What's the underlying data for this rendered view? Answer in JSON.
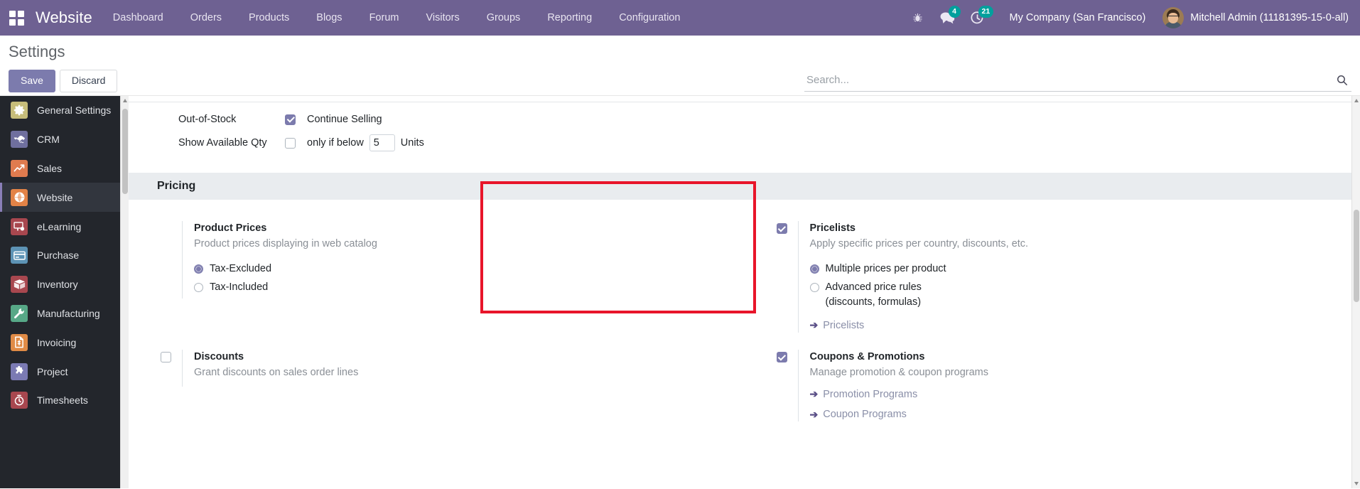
{
  "navbar": {
    "apps_icon": "apps-grid-icon",
    "brand": "Website",
    "menu": [
      {
        "label": "Dashboard"
      },
      {
        "label": "Orders"
      },
      {
        "label": "Products"
      },
      {
        "label": "Blogs"
      },
      {
        "label": "Forum"
      },
      {
        "label": "Visitors"
      },
      {
        "label": "Groups"
      },
      {
        "label": "Reporting"
      },
      {
        "label": "Configuration"
      }
    ],
    "debug_icon": "bug-icon",
    "messages_icon": "chat-bubble-icon",
    "messages_count": "4",
    "activities_icon": "clock-icon",
    "activities_count": "21",
    "company": "My Company (San Francisco)",
    "avatar_icon": "user-avatar",
    "user": "Mitchell Admin (11181395-15-0-all)"
  },
  "control_panel": {
    "title": "Settings",
    "save_label": "Save",
    "discard_label": "Discard",
    "search_placeholder": "Search...",
    "search_value": "",
    "search_icon": "magnifier-icon"
  },
  "sidebar": {
    "items": [
      {
        "label": "General Settings",
        "icon": "gear-icon",
        "active": false
      },
      {
        "label": "CRM",
        "icon": "handshake-icon",
        "active": false
      },
      {
        "label": "Sales",
        "icon": "chart-up-icon",
        "active": false
      },
      {
        "label": "Website",
        "icon": "globe-icon",
        "active": true
      },
      {
        "label": "eLearning",
        "icon": "presentation-icon",
        "active": false
      },
      {
        "label": "Purchase",
        "icon": "credit-card-icon",
        "active": false
      },
      {
        "label": "Inventory",
        "icon": "box-icon",
        "active": false
      },
      {
        "label": "Manufacturing",
        "icon": "wrench-icon",
        "active": false
      },
      {
        "label": "Invoicing",
        "icon": "invoice-icon",
        "active": false
      },
      {
        "label": "Project",
        "icon": "puzzle-icon",
        "active": false
      },
      {
        "label": "Timesheets",
        "icon": "stopwatch-icon",
        "active": false
      }
    ]
  },
  "content": {
    "out_of_stock": {
      "label": "Out-of-Stock",
      "checkbox_checked": true,
      "option_label": "Continue Selling"
    },
    "show_available_qty": {
      "label": "Show Available Qty",
      "checkbox_checked": false,
      "prefix": "only if below",
      "value": "5",
      "suffix": "Units"
    },
    "pricing_section": {
      "title": "Pricing",
      "settings": [
        {
          "name": "product-prices",
          "has_checkbox": false,
          "checked": false,
          "title": "Product Prices",
          "desc": "Product prices displaying in web catalog",
          "radios": [
            {
              "label": "Tax-Excluded",
              "selected": true
            },
            {
              "label": "Tax-Included",
              "selected": false
            }
          ],
          "links": [],
          "highlighted": false
        },
        {
          "name": "pricelists",
          "has_checkbox": true,
          "checked": true,
          "title": "Pricelists",
          "desc": "Apply specific prices per country, discounts, etc.",
          "radios": [
            {
              "label": "Multiple prices per product",
              "selected": true
            },
            {
              "label": "Advanced price rules\n(discounts, formulas)",
              "selected": false
            }
          ],
          "links": [
            {
              "label": "Pricelists"
            }
          ],
          "highlighted": true
        },
        {
          "name": "discounts",
          "has_checkbox": true,
          "checked": false,
          "title": "Discounts",
          "desc": "Grant discounts on sales order lines",
          "radios": [],
          "links": [],
          "highlighted": false
        },
        {
          "name": "coupons-promotions",
          "has_checkbox": true,
          "checked": true,
          "title": "Coupons & Promotions",
          "desc": "Manage promotion & coupon programs",
          "radios": [],
          "links": [
            {
              "label": "Promotion Programs"
            },
            {
              "label": "Coupon Programs"
            }
          ],
          "highlighted": false
        }
      ]
    }
  },
  "colors": {
    "navbar_bg": "#6e6192",
    "primary": "#7c7bad",
    "badge": "#00a09d",
    "sidebar_bg": "#23262c",
    "section_bg": "#e9ecef",
    "annotation": "#e8152a"
  }
}
